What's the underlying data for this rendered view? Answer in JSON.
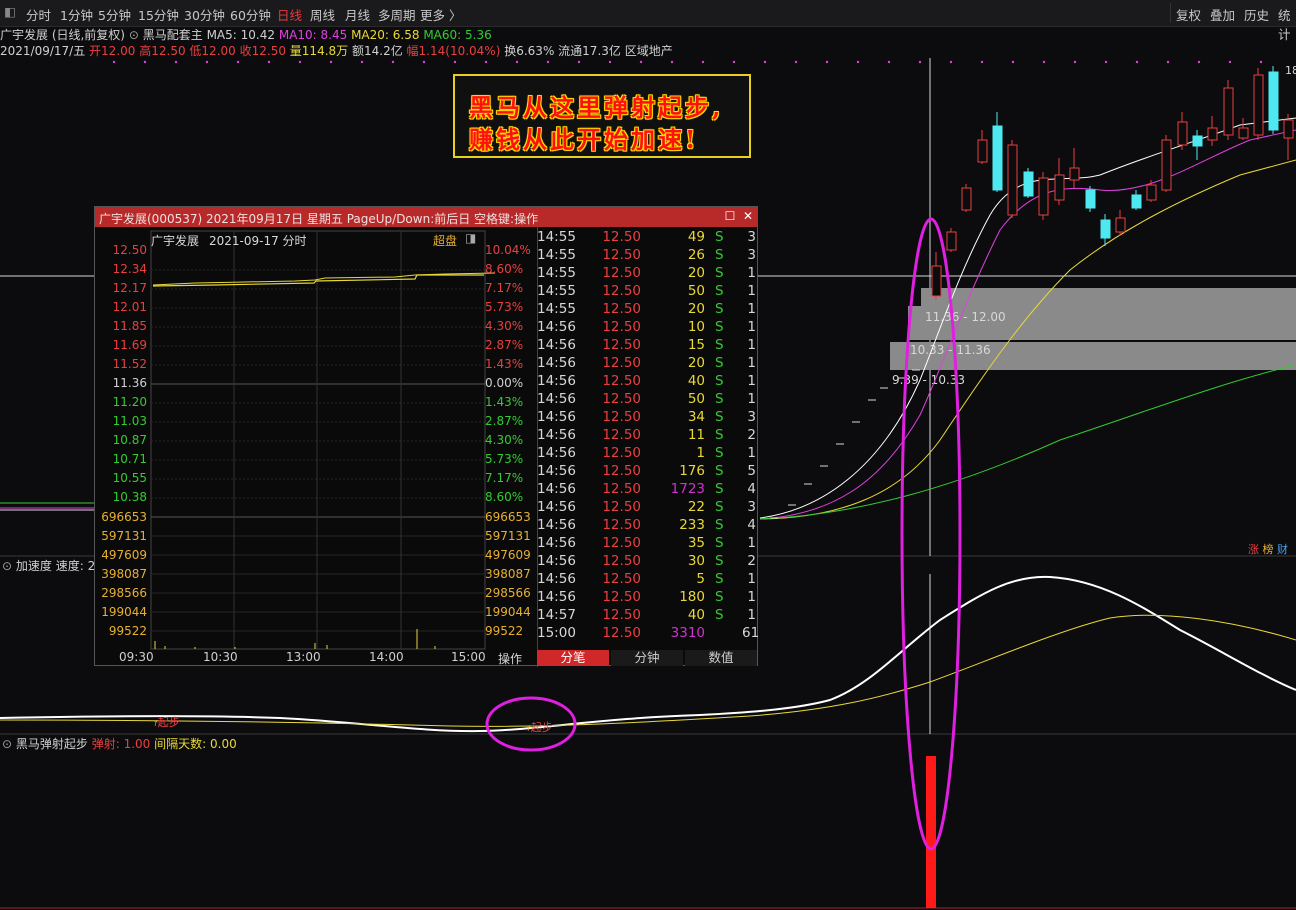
{
  "toolbar": {
    "left": [
      "分时",
      "1分钟",
      "5分钟",
      "15分钟",
      "30分钟",
      "60分钟",
      "日线",
      "周线",
      "月线",
      "多周期",
      "更多 〉"
    ],
    "active": "日线",
    "right": [
      "复权",
      "叠加",
      "历史",
      "统计"
    ]
  },
  "info": {
    "line1": {
      "name": "广宇发展 (日线,前复权)",
      "indicator": "黑马配套主",
      "ma5": "MA5: 10.42",
      "ma10": "MA10: 8.45",
      "ma20": "MA20: 6.58",
      "ma60": "MA60: 5.36"
    },
    "line2": {
      "date": "2021/09/17/五",
      "open": "开12.00",
      "high": "高12.50",
      "low": "低12.00",
      "close": "收12.50",
      "vol": "量114.8万",
      "amt": "额14.2亿",
      "pct": "幅1.14(10.04%)",
      "turn": "换6.63%",
      "float": "流通17.3亿",
      "sector": "区域地产"
    }
  },
  "callout": {
    "line1": "黑马从这里弹射起步,",
    "line2": "赚钱从此开始加速!"
  },
  "price_boxes": [
    {
      "label": "11.36 - 12.00"
    },
    {
      "label": "10.33 - 11.36"
    },
    {
      "label": "9.39 - 10.33"
    }
  ],
  "top_right_label": "18",
  "badges": [
    "涨",
    "榜",
    "财"
  ],
  "panel2": {
    "name": "加速度",
    "param": "速度: 2",
    "signal": "起步"
  },
  "panel3": {
    "name": "黑马弹射起步",
    "p1": "弹射: 1.00",
    "p2": "间隔天数: 0.00"
  },
  "popup": {
    "title": "广宇发展(000537) 2021年09月17日 星期五 PageUp/Down:前后日 空格键:操作",
    "head_name": "广宇发展",
    "head_date": "2021-09-17 分时",
    "head_tag": "超盘",
    "left_prices": [
      "12.50",
      "12.34",
      "12.17",
      "12.01",
      "11.85",
      "11.69",
      "11.52",
      "11.36",
      "11.20",
      "11.03",
      "10.87",
      "10.71",
      "10.55",
      "10.38"
    ],
    "right_pcts": [
      "10.04%",
      "8.60%",
      "7.17%",
      "5.73%",
      "4.30%",
      "2.87%",
      "1.43%",
      "0.00%",
      "1.43%",
      "2.87%",
      "4.30%",
      "5.73%",
      "7.17%",
      "8.60%"
    ],
    "vol_labels": [
      "696653",
      "597131",
      "497609",
      "398087",
      "298566",
      "199044",
      "99522"
    ],
    "time_labels": [
      "09:30",
      "10:30",
      "13:00",
      "14:00",
      "15:00"
    ],
    "op_label": "操作",
    "tabs": [
      "分笔",
      "分钟",
      "数值"
    ],
    "active_tab": "分笔",
    "ticks": [
      [
        "14:55",
        "12.50",
        "49",
        "S",
        "3"
      ],
      [
        "14:55",
        "12.50",
        "26",
        "S",
        "3"
      ],
      [
        "14:55",
        "12.50",
        "20",
        "S",
        "1"
      ],
      [
        "14:55",
        "12.50",
        "50",
        "S",
        "1"
      ],
      [
        "14:55",
        "12.50",
        "20",
        "S",
        "1"
      ],
      [
        "14:56",
        "12.50",
        "10",
        "S",
        "1"
      ],
      [
        "14:56",
        "12.50",
        "15",
        "S",
        "1"
      ],
      [
        "14:56",
        "12.50",
        "20",
        "S",
        "1"
      ],
      [
        "14:56",
        "12.50",
        "40",
        "S",
        "1"
      ],
      [
        "14:56",
        "12.50",
        "50",
        "S",
        "1"
      ],
      [
        "14:56",
        "12.50",
        "34",
        "S",
        "3"
      ],
      [
        "14:56",
        "12.50",
        "11",
        "S",
        "2"
      ],
      [
        "14:56",
        "12.50",
        "1",
        "S",
        "1"
      ],
      [
        "14:56",
        "12.50",
        "176",
        "S",
        "5"
      ],
      [
        "14:56",
        "12.50",
        "1723",
        "S",
        "4"
      ],
      [
        "14:56",
        "12.50",
        "22",
        "S",
        "3"
      ],
      [
        "14:56",
        "12.50",
        "233",
        "S",
        "4"
      ],
      [
        "14:56",
        "12.50",
        "35",
        "S",
        "1"
      ],
      [
        "14:56",
        "12.50",
        "30",
        "S",
        "2"
      ],
      [
        "14:56",
        "12.50",
        "5",
        "S",
        "1"
      ],
      [
        "14:56",
        "12.50",
        "180",
        "S",
        "1"
      ],
      [
        "14:57",
        "12.50",
        "40",
        "S",
        "1"
      ],
      [
        "15:00",
        "12.50",
        "3310",
        "",
        "61"
      ]
    ]
  }
}
